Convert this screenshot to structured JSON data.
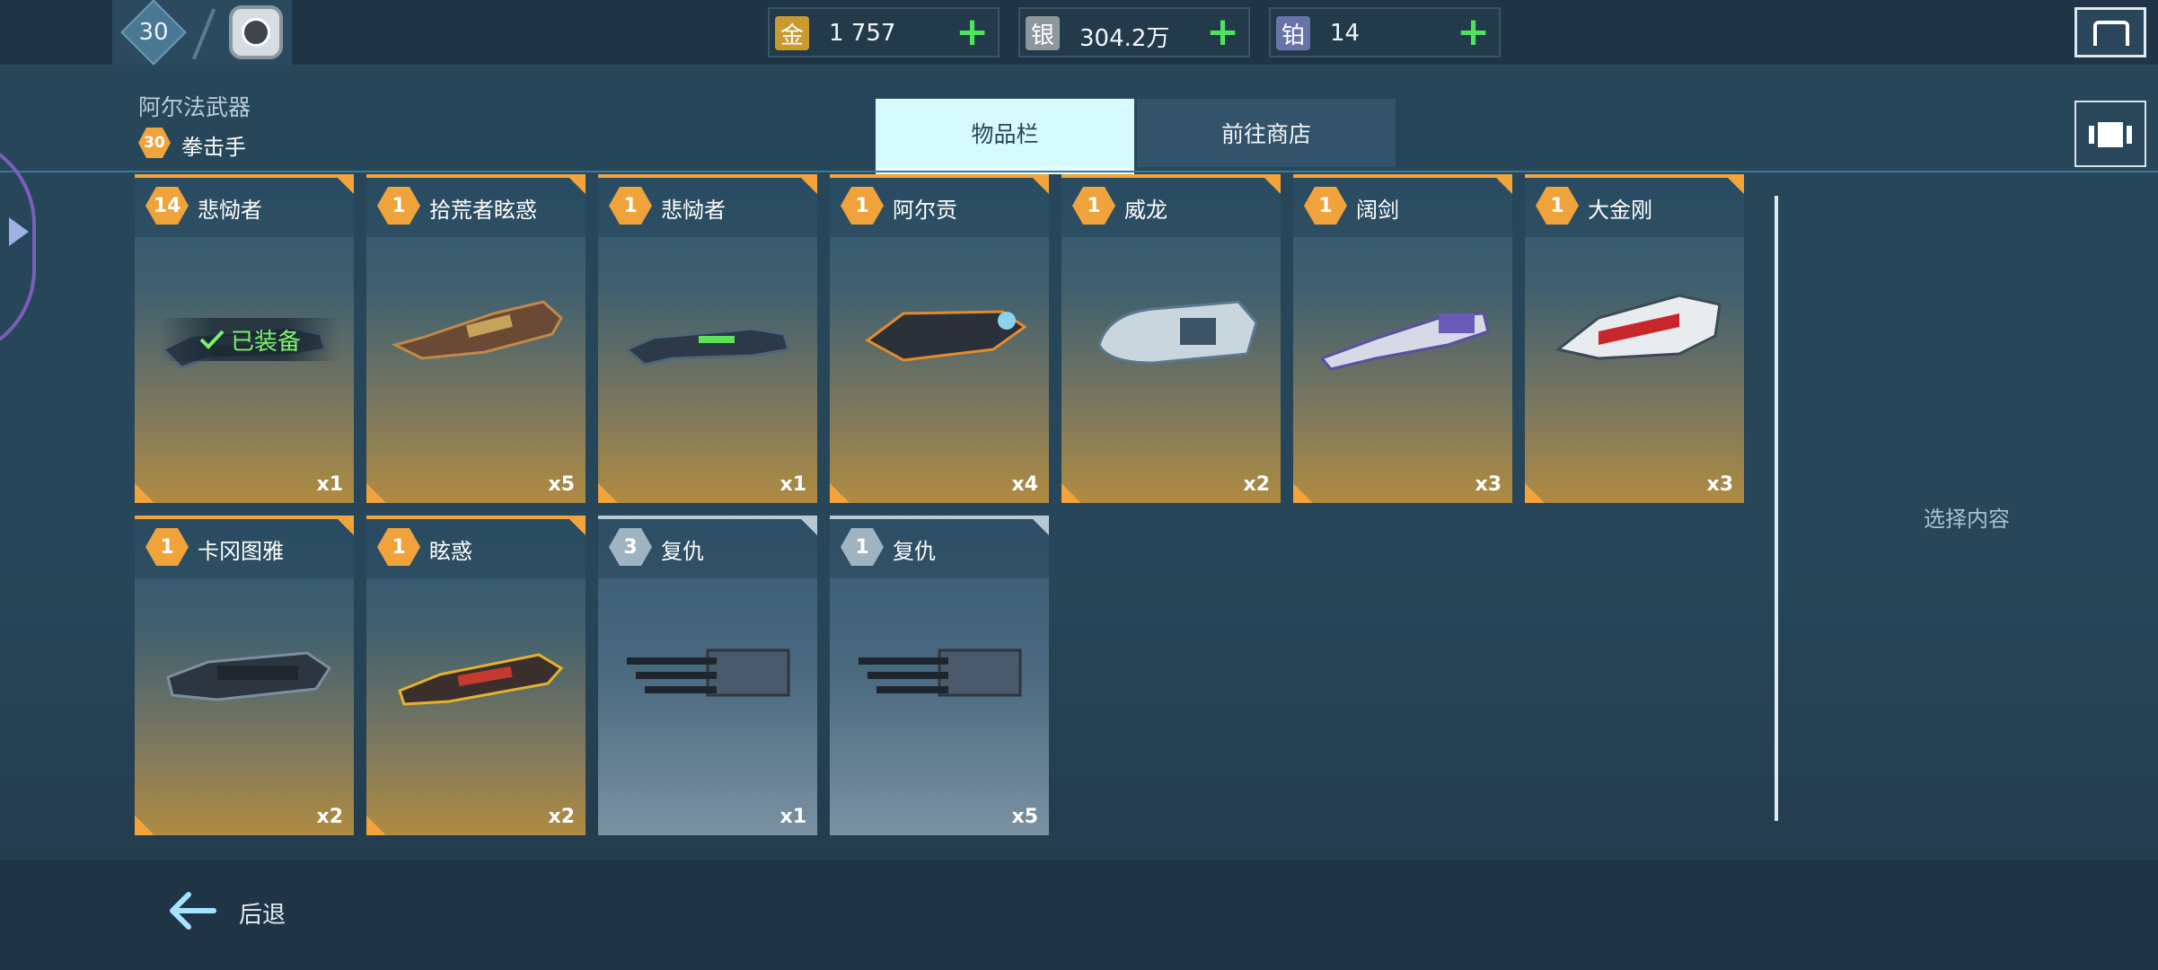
{
  "topbar": {
    "player_level": "30",
    "currencies": [
      {
        "icon": "金",
        "value": "1 757",
        "color": "#c99a2e"
      },
      {
        "icon": "银",
        "value": "304.2万",
        "color": "#8d979d"
      },
      {
        "icon": "铂",
        "value": "14",
        "color": "#6874a8"
      }
    ],
    "plus": "+"
  },
  "header": {
    "section_title": "阿尔法武器",
    "subtype_level": "30",
    "subtype_label": "拳击手",
    "tabs": [
      {
        "label": "物品栏",
        "active": true
      },
      {
        "label": "前往商店",
        "active": false
      }
    ]
  },
  "items": [
    {
      "level": "14",
      "name": "悲恸者",
      "qty": "x1",
      "rarity": "gold",
      "equipped": true
    },
    {
      "level": "1",
      "name": "拾荒者眩惑",
      "qty": "x5",
      "rarity": "gold"
    },
    {
      "level": "1",
      "name": "悲恸者",
      "qty": "x1",
      "rarity": "gold"
    },
    {
      "level": "1",
      "name": "阿尔贡",
      "qty": "x4",
      "rarity": "gold"
    },
    {
      "level": "1",
      "name": "威龙",
      "qty": "x2",
      "rarity": "gold"
    },
    {
      "level": "1",
      "name": "阔剑",
      "qty": "x3",
      "rarity": "gold"
    },
    {
      "level": "1",
      "name": "大金刚",
      "qty": "x3",
      "rarity": "gold"
    },
    {
      "level": "1",
      "name": "卡冈图雅",
      "qty": "x2",
      "rarity": "gold"
    },
    {
      "level": "1",
      "name": "眩惑",
      "qty": "x2",
      "rarity": "gold"
    },
    {
      "level": "3",
      "name": "复仇",
      "qty": "x1",
      "rarity": "grey"
    },
    {
      "level": "1",
      "name": "复仇",
      "qty": "x5",
      "rarity": "grey"
    }
  ],
  "equipped_label": "已装备",
  "detail": {
    "placeholder": "选择内容"
  },
  "footer": {
    "back_label": "后退"
  },
  "colors": {
    "accent_gold": "#f2a33a",
    "accent_grey": "#b8c8d3",
    "equipped_green": "#7df06a",
    "plus_green": "#4fe35b"
  }
}
